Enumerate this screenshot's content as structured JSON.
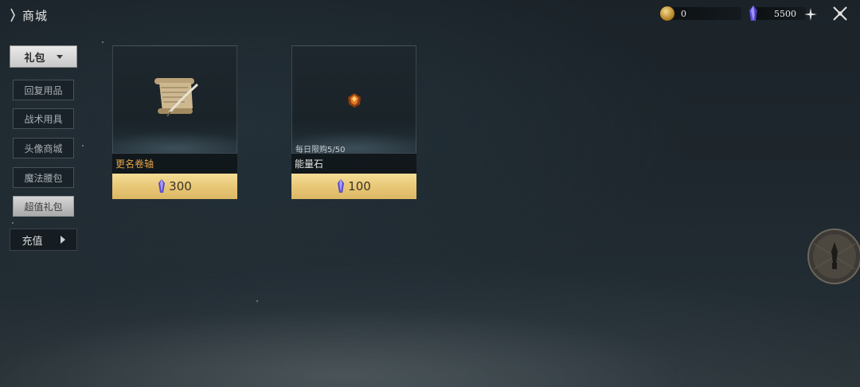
{
  "header": {
    "title": "商城"
  },
  "currencies": {
    "gold": {
      "icon": "gold-coin-icon",
      "value": "0"
    },
    "gem": {
      "icon": "blue-crystal-icon",
      "value": "5500"
    }
  },
  "sidebar": {
    "dropdown_label": "礼包",
    "items": [
      {
        "label": "回复用品",
        "active": false
      },
      {
        "label": "战术用具",
        "active": false
      },
      {
        "label": "头像商城",
        "active": false
      },
      {
        "label": "魔法腰包",
        "active": false
      },
      {
        "label": "超值礼包",
        "active": true
      }
    ],
    "recharge_label": "充值"
  },
  "shop_items": [
    {
      "name": "更名卷轴",
      "name_color": "#e2a44a",
      "icon": "scroll-quill-icon",
      "limit": "",
      "price": "300",
      "price_icon": "blue-crystal-icon"
    },
    {
      "name": "能量石",
      "name_color": "#e6e6e6",
      "icon": "energy-stone-icon",
      "limit": "每日限购5/50",
      "price": "100",
      "price_icon": "blue-crystal-icon"
    }
  ],
  "colors": {
    "price_gold": "#e8c877",
    "accent_orange": "#e2a44a"
  }
}
